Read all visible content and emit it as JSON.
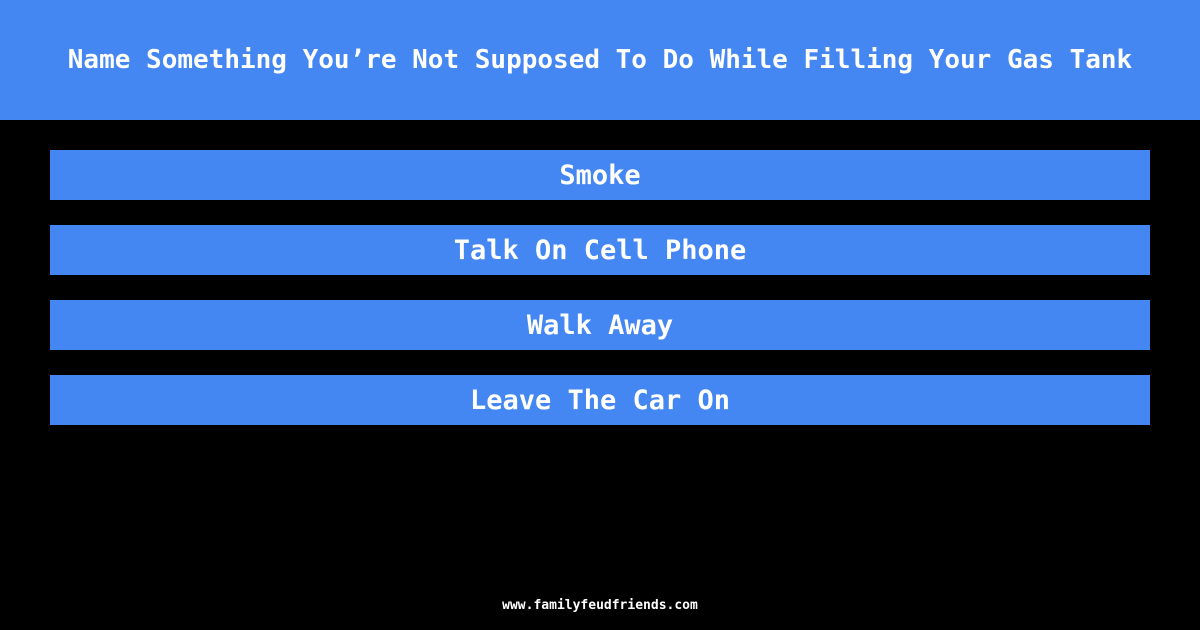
{
  "question": "Name Something You’re Not Supposed To Do While Filling Your Gas Tank",
  "answers": [
    {
      "label": "Smoke"
    },
    {
      "label": "Talk On Cell Phone"
    },
    {
      "label": "Walk Away"
    },
    {
      "label": "Leave The Car On"
    }
  ],
  "footer": "www.familyfeudfriends.com",
  "colors": {
    "accent": "#4487f2",
    "background": "#000000",
    "text": "#ffffff"
  }
}
